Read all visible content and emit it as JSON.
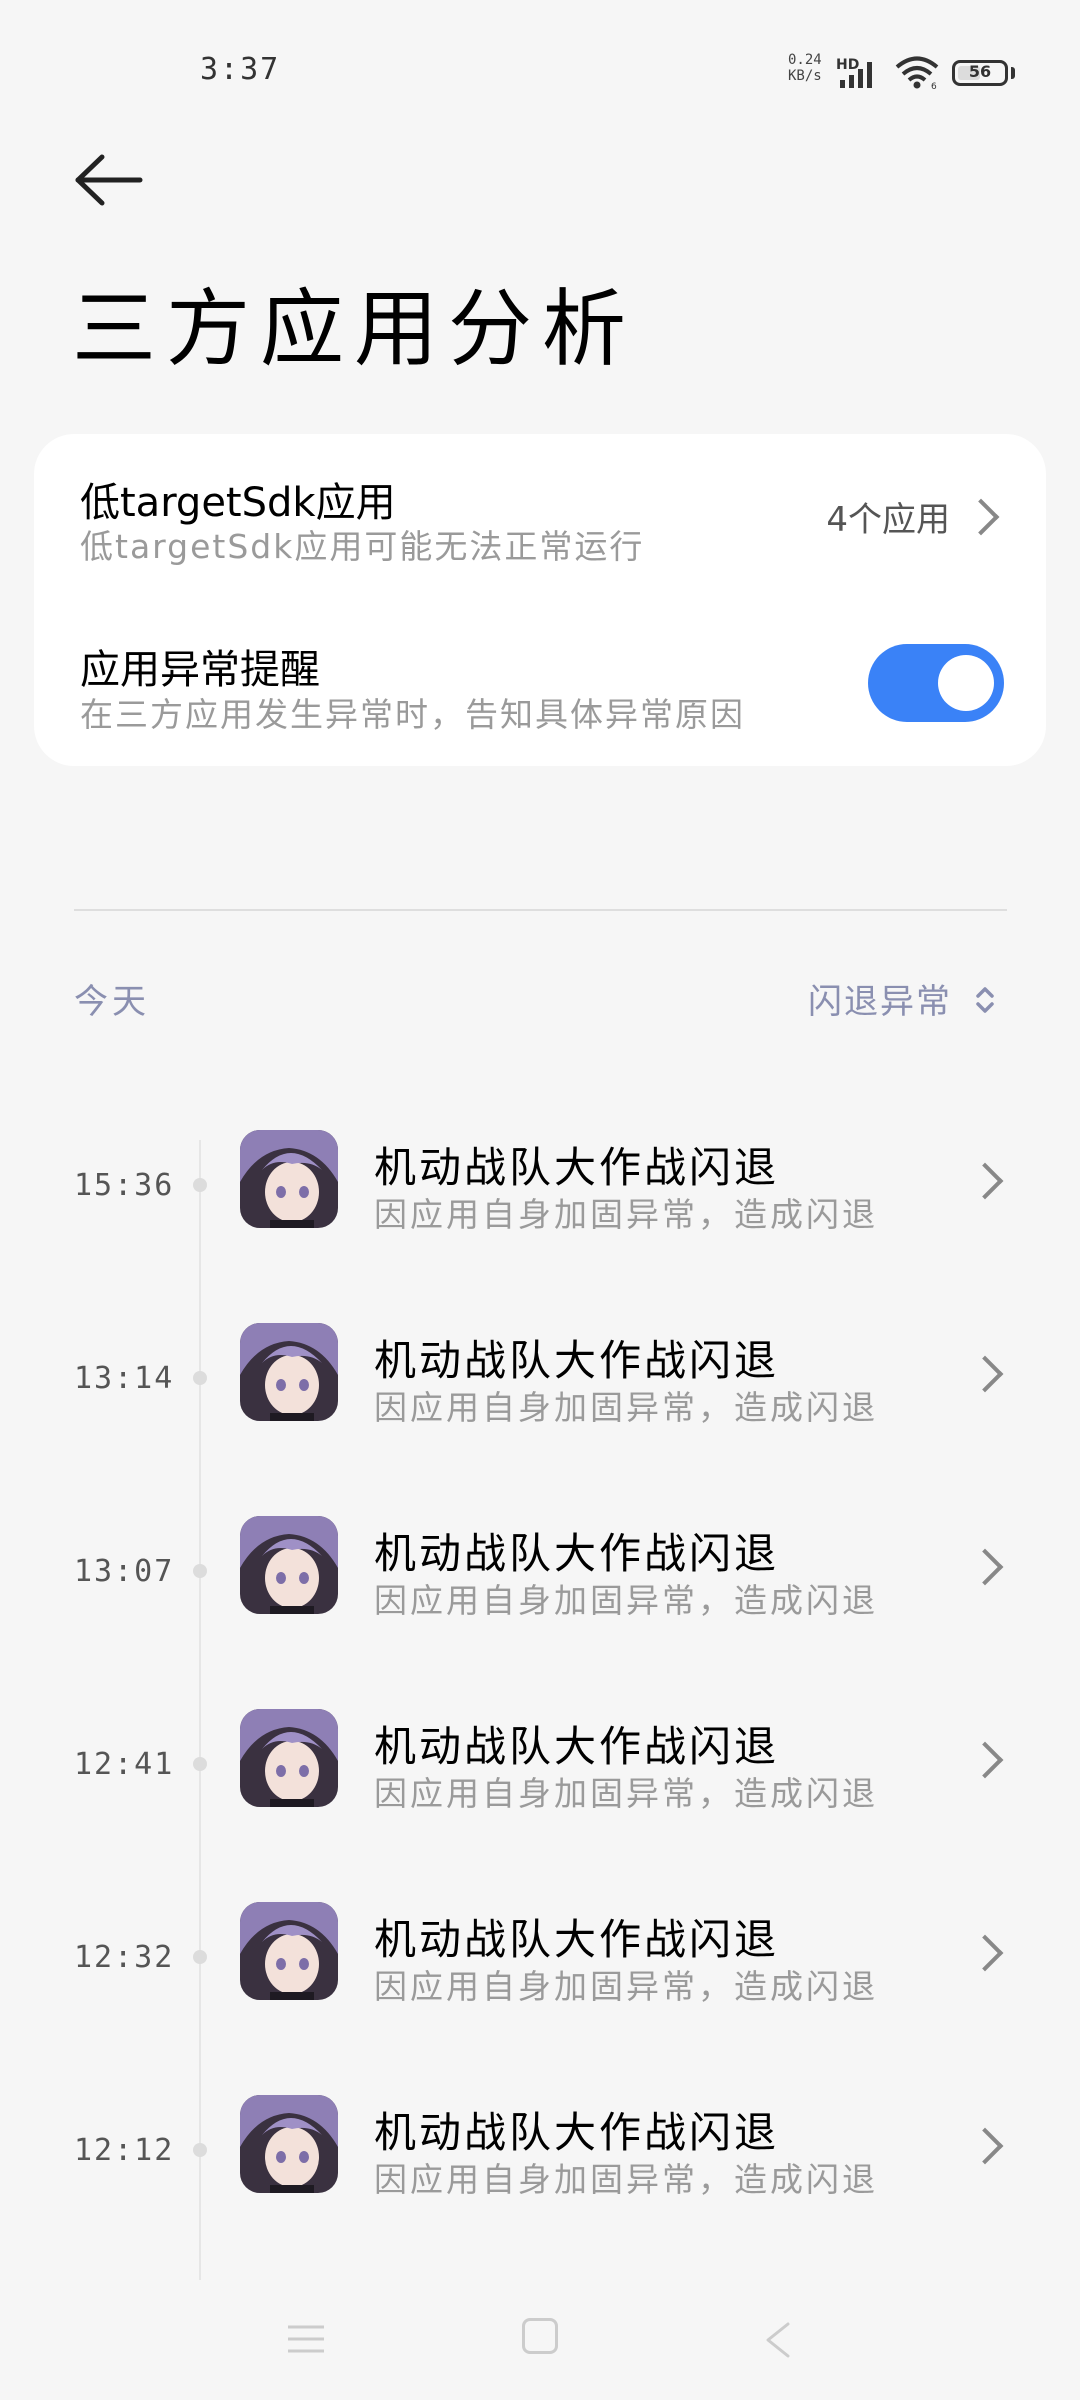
{
  "status_bar": {
    "time": "3:37",
    "net_speed_value": "0.24",
    "net_speed_unit": "KB/s",
    "hd": "HD",
    "battery": "56",
    "battery_level": 0.56,
    "icons": [
      "hd-icon",
      "signal-icon",
      "wifi-icon",
      "battery-icon"
    ]
  },
  "header": {
    "back_icon": "back-arrow-icon",
    "title": "三方应用分析"
  },
  "settings": {
    "low_target": {
      "title": "低targetSdk应用",
      "subtitle": "低targetSdk应用可能无法正常运行",
      "value": "4个应用"
    },
    "abnormal_alert": {
      "title": "应用异常提醒",
      "subtitle": "在三方应用发生异常时，告知具体异常原因",
      "enabled": true
    }
  },
  "log": {
    "day": "今天",
    "filter": "闪退异常",
    "entries": [
      {
        "time": "15:36",
        "title": "机动战队大作战闪退",
        "subtitle": "因应用自身加固异常，造成闪退"
      },
      {
        "time": "13:14",
        "title": "机动战队大作战闪退",
        "subtitle": "因应用自身加固异常，造成闪退"
      },
      {
        "time": "13:07",
        "title": "机动战队大作战闪退",
        "subtitle": "因应用自身加固异常，造成闪退"
      },
      {
        "time": "12:41",
        "title": "机动战队大作战闪退",
        "subtitle": "因应用自身加固异常，造成闪退"
      },
      {
        "time": "12:32",
        "title": "机动战队大作战闪退",
        "subtitle": "因应用自身加固异常，造成闪退"
      },
      {
        "time": "12:12",
        "title": "机动战队大作战闪退",
        "subtitle": "因应用自身加固异常，造成闪退"
      }
    ]
  },
  "colors": {
    "accent": "#3a82f7",
    "muted_label": "#8a8fb0",
    "background": "#f6f6f6"
  },
  "nav_bar": {
    "icons": [
      "menu-icon",
      "home-icon",
      "back-icon"
    ]
  }
}
